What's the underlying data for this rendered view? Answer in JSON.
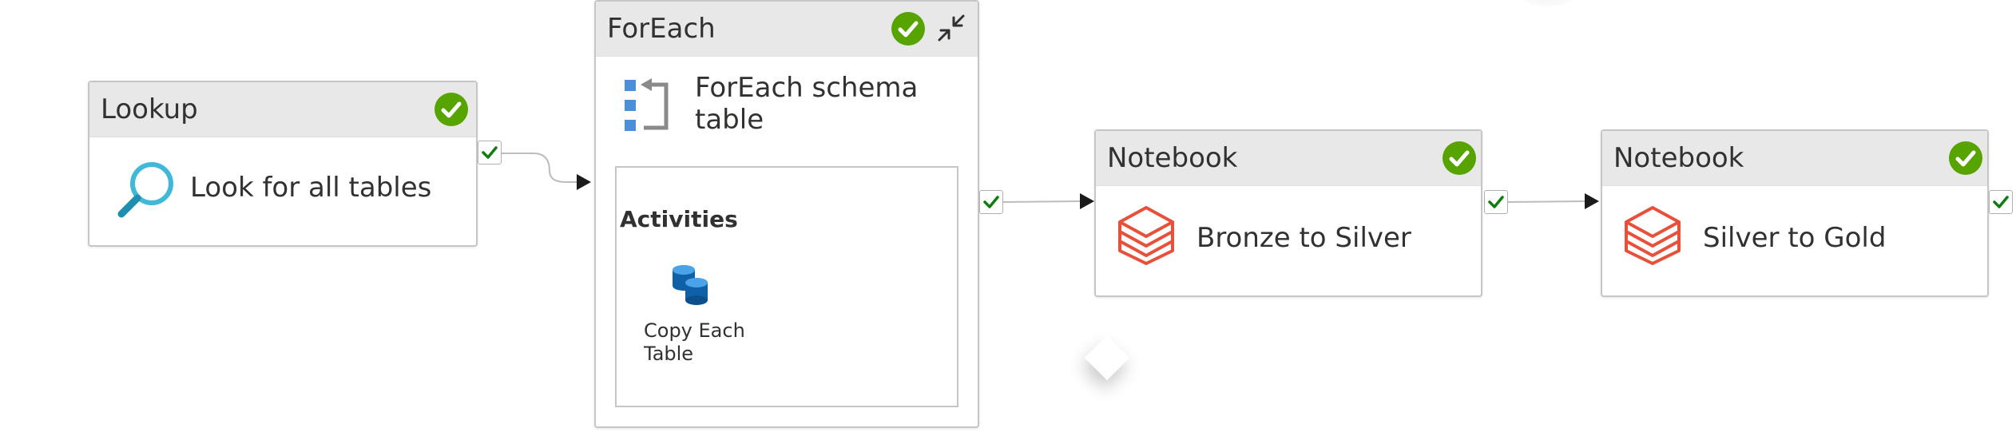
{
  "pipeline": {
    "lookup": {
      "type": "Lookup",
      "name": "Look for all tables",
      "status": "succeeded",
      "icon": "search-icon"
    },
    "foreach": {
      "type": "ForEach",
      "name_line1": "ForEach schema",
      "name_line2": "table",
      "status": "succeeded",
      "icon": "foreach-icon",
      "activities_label": "Activities",
      "inner_activity": {
        "name_line1": "Copy Each",
        "name_line2": "Table",
        "icon": "copy-data-icon"
      }
    },
    "notebook1": {
      "type": "Notebook",
      "name": "Bronze to Silver",
      "status": "succeeded",
      "icon": "databricks-icon"
    },
    "notebook2": {
      "type": "Notebook",
      "name": "Silver to Gold",
      "status": "succeeded",
      "icon": "databricks-icon"
    }
  },
  "colors": {
    "success": "#57a300",
    "header_bg": "#e8e8e8",
    "border": "#c8c6c4",
    "lookup_icon": "#40b8d8",
    "databricks": "#e8503a",
    "foreach_icon": "#4a90d9"
  }
}
